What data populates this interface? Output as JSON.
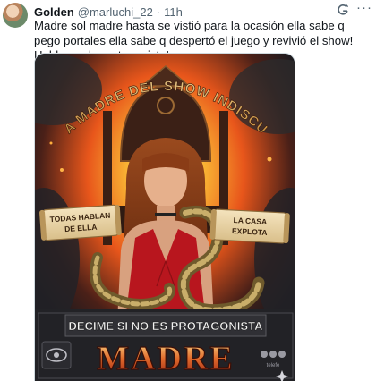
{
  "author": {
    "name": "Golden",
    "handle": "@marluchi_22",
    "separator": "·",
    "time": "11h",
    "avatar_icon": "profile-avatar"
  },
  "tweet": {
    "text": "Madre sol madre hasta se vistió para la ocasión ella sabe q pego portales ella sabe q despertó el juego y revivió el show! Hablame de protagonista!"
  },
  "actions": {
    "more_label": "···",
    "grok_icon": "grok-icon"
  },
  "poster": {
    "arc_title": "REINA MADRE DEL SHOW INDISCUTIDA",
    "left_scroll": [
      "TODAS HABLAN",
      "DE ELLA"
    ],
    "right_scroll": [
      "LA CASA",
      "EXPLOTA"
    ],
    "banner_line": "DECIME SI NO ES PROTAGONISTA",
    "banner_big": "MADRE",
    "corner_left_icon": "eye-logo-icon",
    "corner_right_label": "telefe",
    "sparkle_icon": "sparkle-icon",
    "colors": {
      "fire": "#f28a1b",
      "gold": "#e8c27a",
      "banner_text": "#d2512b",
      "dress": "#b8161e"
    }
  }
}
